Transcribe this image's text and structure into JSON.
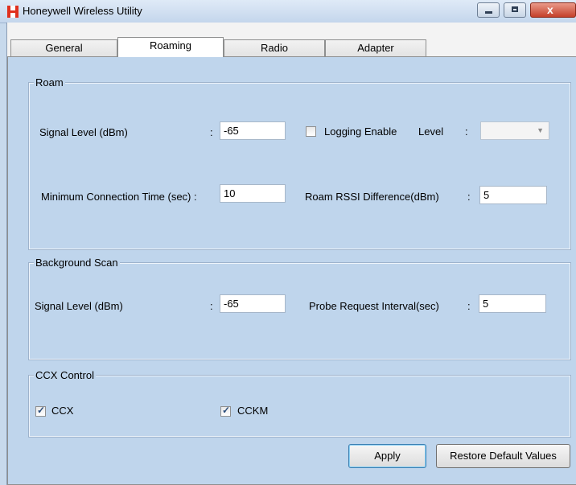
{
  "window": {
    "title": "Honeywell Wireless Utility",
    "close_symbol": "x"
  },
  "tabs": [
    {
      "label": "General"
    },
    {
      "label": "Roaming",
      "active": true
    },
    {
      "label": "Radio"
    },
    {
      "label": "Adapter"
    }
  ],
  "roam": {
    "title": "Roam",
    "signal_level_label": "Signal  Level (dBm)",
    "signal_level_value": "-65",
    "logging_enable_label": "Logging Enable",
    "logging_enable_checked": false,
    "level_label": "Level",
    "level_value": "",
    "min_conn_time_label": "Minimum Connection Time (sec) :",
    "min_conn_time_value": "10",
    "rssi_diff_label": "Roam RSSI Difference(dBm)",
    "rssi_diff_value": "5",
    "colon": ":"
  },
  "background_scan": {
    "title": "Background Scan",
    "signal_level_label": "Signal Level (dBm)",
    "signal_level_value": "-65",
    "probe_interval_label": "Probe Request Interval(sec)",
    "probe_interval_value": "5",
    "colon": ":"
  },
  "ccx_control": {
    "title": "CCX Control",
    "ccx_label": "CCX",
    "ccx_checked": true,
    "cckm_label": "CCKM",
    "cckm_checked": true
  },
  "buttons": {
    "apply": "Apply",
    "restore": "Restore Default Values"
  },
  "colors": {
    "panel_bg": "#bfd5ec",
    "logo_red": "#e0301e"
  }
}
